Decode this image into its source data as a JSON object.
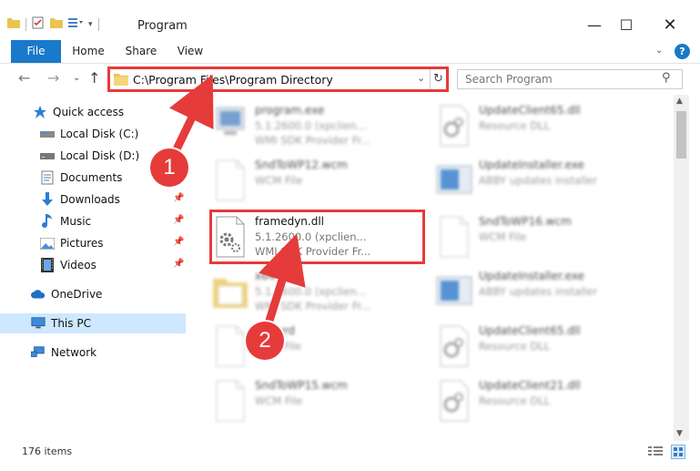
{
  "window": {
    "title": "Program",
    "minimize": "—",
    "maximize": "☐",
    "close": "✕"
  },
  "ribbon": {
    "tabs": [
      "File",
      "Home",
      "Share",
      "View"
    ],
    "help": "?"
  },
  "navbar": {
    "address": "C:\\Program Files\\Program Directory",
    "search_placeholder": "Search Program"
  },
  "sidebar": {
    "items": [
      {
        "label": "Quick access",
        "icon": "star-icon",
        "pinned": false
      },
      {
        "label": "Local Disk (C:)",
        "icon": "drive-icon",
        "pinned": false
      },
      {
        "label": "Local Disk (D:)",
        "icon": "drive-icon",
        "pinned": false
      },
      {
        "label": "Documents",
        "icon": "documents-icon",
        "pinned": false
      },
      {
        "label": "Downloads",
        "icon": "download-icon",
        "pinned": true
      },
      {
        "label": "Music",
        "icon": "music-icon",
        "pinned": true
      },
      {
        "label": "Pictures",
        "icon": "pictures-icon",
        "pinned": true
      },
      {
        "label": "Videos",
        "icon": "videos-icon",
        "pinned": true
      },
      {
        "label": "OneDrive",
        "icon": "onedrive-icon",
        "pinned": false
      },
      {
        "label": "This PC",
        "icon": "pc-icon",
        "pinned": false,
        "selected": true
      },
      {
        "label": "Network",
        "icon": "network-icon",
        "pinned": false
      }
    ]
  },
  "files": [
    {
      "name": "program.exe",
      "line2": "5.1.2600.0 (xpclien...",
      "line3": "WMI SDK Provider Fr...",
      "icon": "exe-icon",
      "blurred": true
    },
    {
      "name": "UpdateClient65.dll",
      "line2": "Resource DLL",
      "line3": "",
      "icon": "dll-icon",
      "blurred": true
    },
    {
      "name": "SndToWP12.wcm",
      "line2": "WCM File",
      "line3": "",
      "icon": "file-icon",
      "blurred": true
    },
    {
      "name": "UpdateInstaller.exe",
      "line2": "ABBY updates installer",
      "line3": "",
      "icon": "installer-icon",
      "blurred": true
    },
    {
      "name": "framedyn.dll",
      "line2": "5.1.2600.0 (xpclien...",
      "line3": "WMI SDK Provider Fr...",
      "icon": "dll-gear-icon",
      "blurred": false
    },
    {
      "name": "SndToWP16.wcm",
      "line2": "WCM File",
      "line3": "",
      "icon": "file-icon",
      "blurred": true
    },
    {
      "name": "x64",
      "line2": "5.1.2600.0 (xpclien...",
      "line3": "WMI SDK Provider Fr...",
      "icon": "folder-icon",
      "blurred": true
    },
    {
      "name": "UpdateInstaller.exe",
      "line2": "ABBY updates installer",
      "line3": "",
      "icon": "installer-icon",
      "blurred": true
    },
    {
      "name": "...c.wrd",
      "line2": "WRD File",
      "line3": "",
      "icon": "file-icon",
      "blurred": true
    },
    {
      "name": "UpdateClient65.dll",
      "line2": "Resource DLL",
      "line3": "",
      "icon": "dll-icon",
      "blurred": true
    },
    {
      "name": "SndToWP15.wcm",
      "line2": "WCM File",
      "line3": "",
      "icon": "file-icon",
      "blurred": true
    },
    {
      "name": "UpdateClient21.dll",
      "line2": "Resource DLL",
      "line3": "",
      "icon": "dll-icon",
      "blurred": true
    }
  ],
  "status": {
    "item_count": "176 items"
  },
  "callouts": [
    "1",
    "2"
  ],
  "colors": {
    "accent": "#1979ca",
    "highlight": "#e63b3b",
    "selected": "#cde8ff"
  }
}
